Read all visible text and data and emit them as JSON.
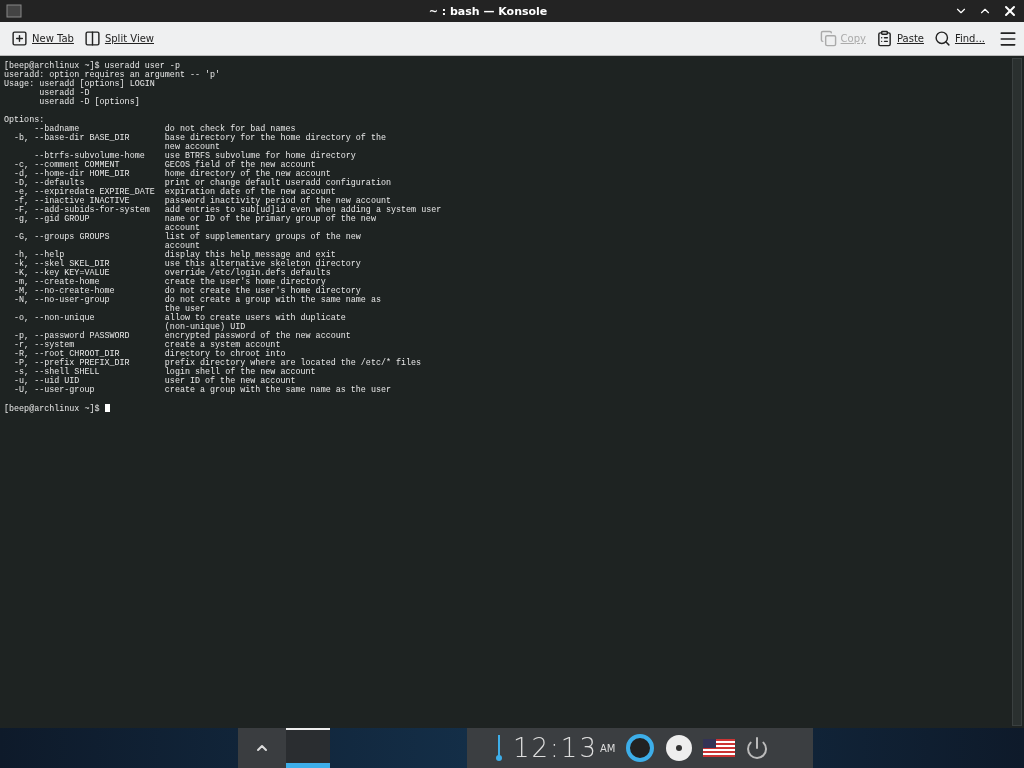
{
  "window": {
    "title": "~ : bash — Konsole"
  },
  "toolbar": {
    "left": [
      {
        "kind": "new-tab",
        "label": "New Tab",
        "disabled": false
      },
      {
        "kind": "split",
        "label": "Split View",
        "disabled": false
      }
    ],
    "right": [
      {
        "kind": "copy",
        "label": "Copy",
        "disabled": true
      },
      {
        "kind": "paste",
        "label": "Paste",
        "disabled": false
      },
      {
        "kind": "find",
        "label": "Find...",
        "disabled": false
      }
    ]
  },
  "terminal": {
    "blocks": [
      [
        "[beep@archlinux ~]$ useradd user -p",
        "useradd: option requires an argument -- 'p'",
        "Usage: useradd [options] LOGIN",
        "       useradd -D",
        "       useradd -D [options]"
      ],
      [
        "Options:",
        "      --badname                 do not check for bad names",
        "  -b, --base-dir BASE_DIR       base directory for the home directory of the",
        "                                new account",
        "      --btrfs-subvolume-home    use BTRFS subvolume for home directory",
        "  -c, --comment COMMENT         GECOS field of the new account",
        "  -d, --home-dir HOME_DIR       home directory of the new account",
        "  -D, --defaults                print or change default useradd configuration",
        "  -e, --expiredate EXPIRE_DATE  expiration date of the new account",
        "  -f, --inactive INACTIVE       password inactivity period of the new account",
        "  -F, --add-subids-for-system   add entries to sub[ud]id even when adding a system user",
        "  -g, --gid GROUP               name or ID of the primary group of the new",
        "                                account",
        "  -G, --groups GROUPS           list of supplementary groups of the new",
        "                                account",
        "  -h, --help                    display this help message and exit",
        "  -k, --skel SKEL_DIR           use this alternative skeleton directory",
        "  -K, --key KEY=VALUE           override /etc/login.defs defaults",
        "  -m, --create-home             create the user's home directory",
        "  -M, --no-create-home          do not create the user's home directory",
        "  -N, --no-user-group           do not create a group with the same name as",
        "                                the user",
        "  -o, --non-unique              allow to create users with duplicate",
        "                                (non-unique) UID",
        "  -p, --password PASSWORD       encrypted password of the new account",
        "  -r, --system                  create a system account",
        "  -R, --root CHROOT_DIR         directory to chroot into",
        "  -P, --prefix PREFIX_DIR       prefix directory where are located the /etc/* files",
        "  -s, --shell SHELL             login shell of the new account",
        "  -u, --uid UID                 user ID of the new account",
        "  -U, --user-group              create a group with the same name as the user"
      ]
    ],
    "prompt": "[beep@archlinux ~]$ "
  },
  "taskbar": {
    "tasks": [
      {
        "selected": true
      }
    ],
    "clock": {
      "time": "12:13",
      "meridiem": "AM"
    }
  }
}
